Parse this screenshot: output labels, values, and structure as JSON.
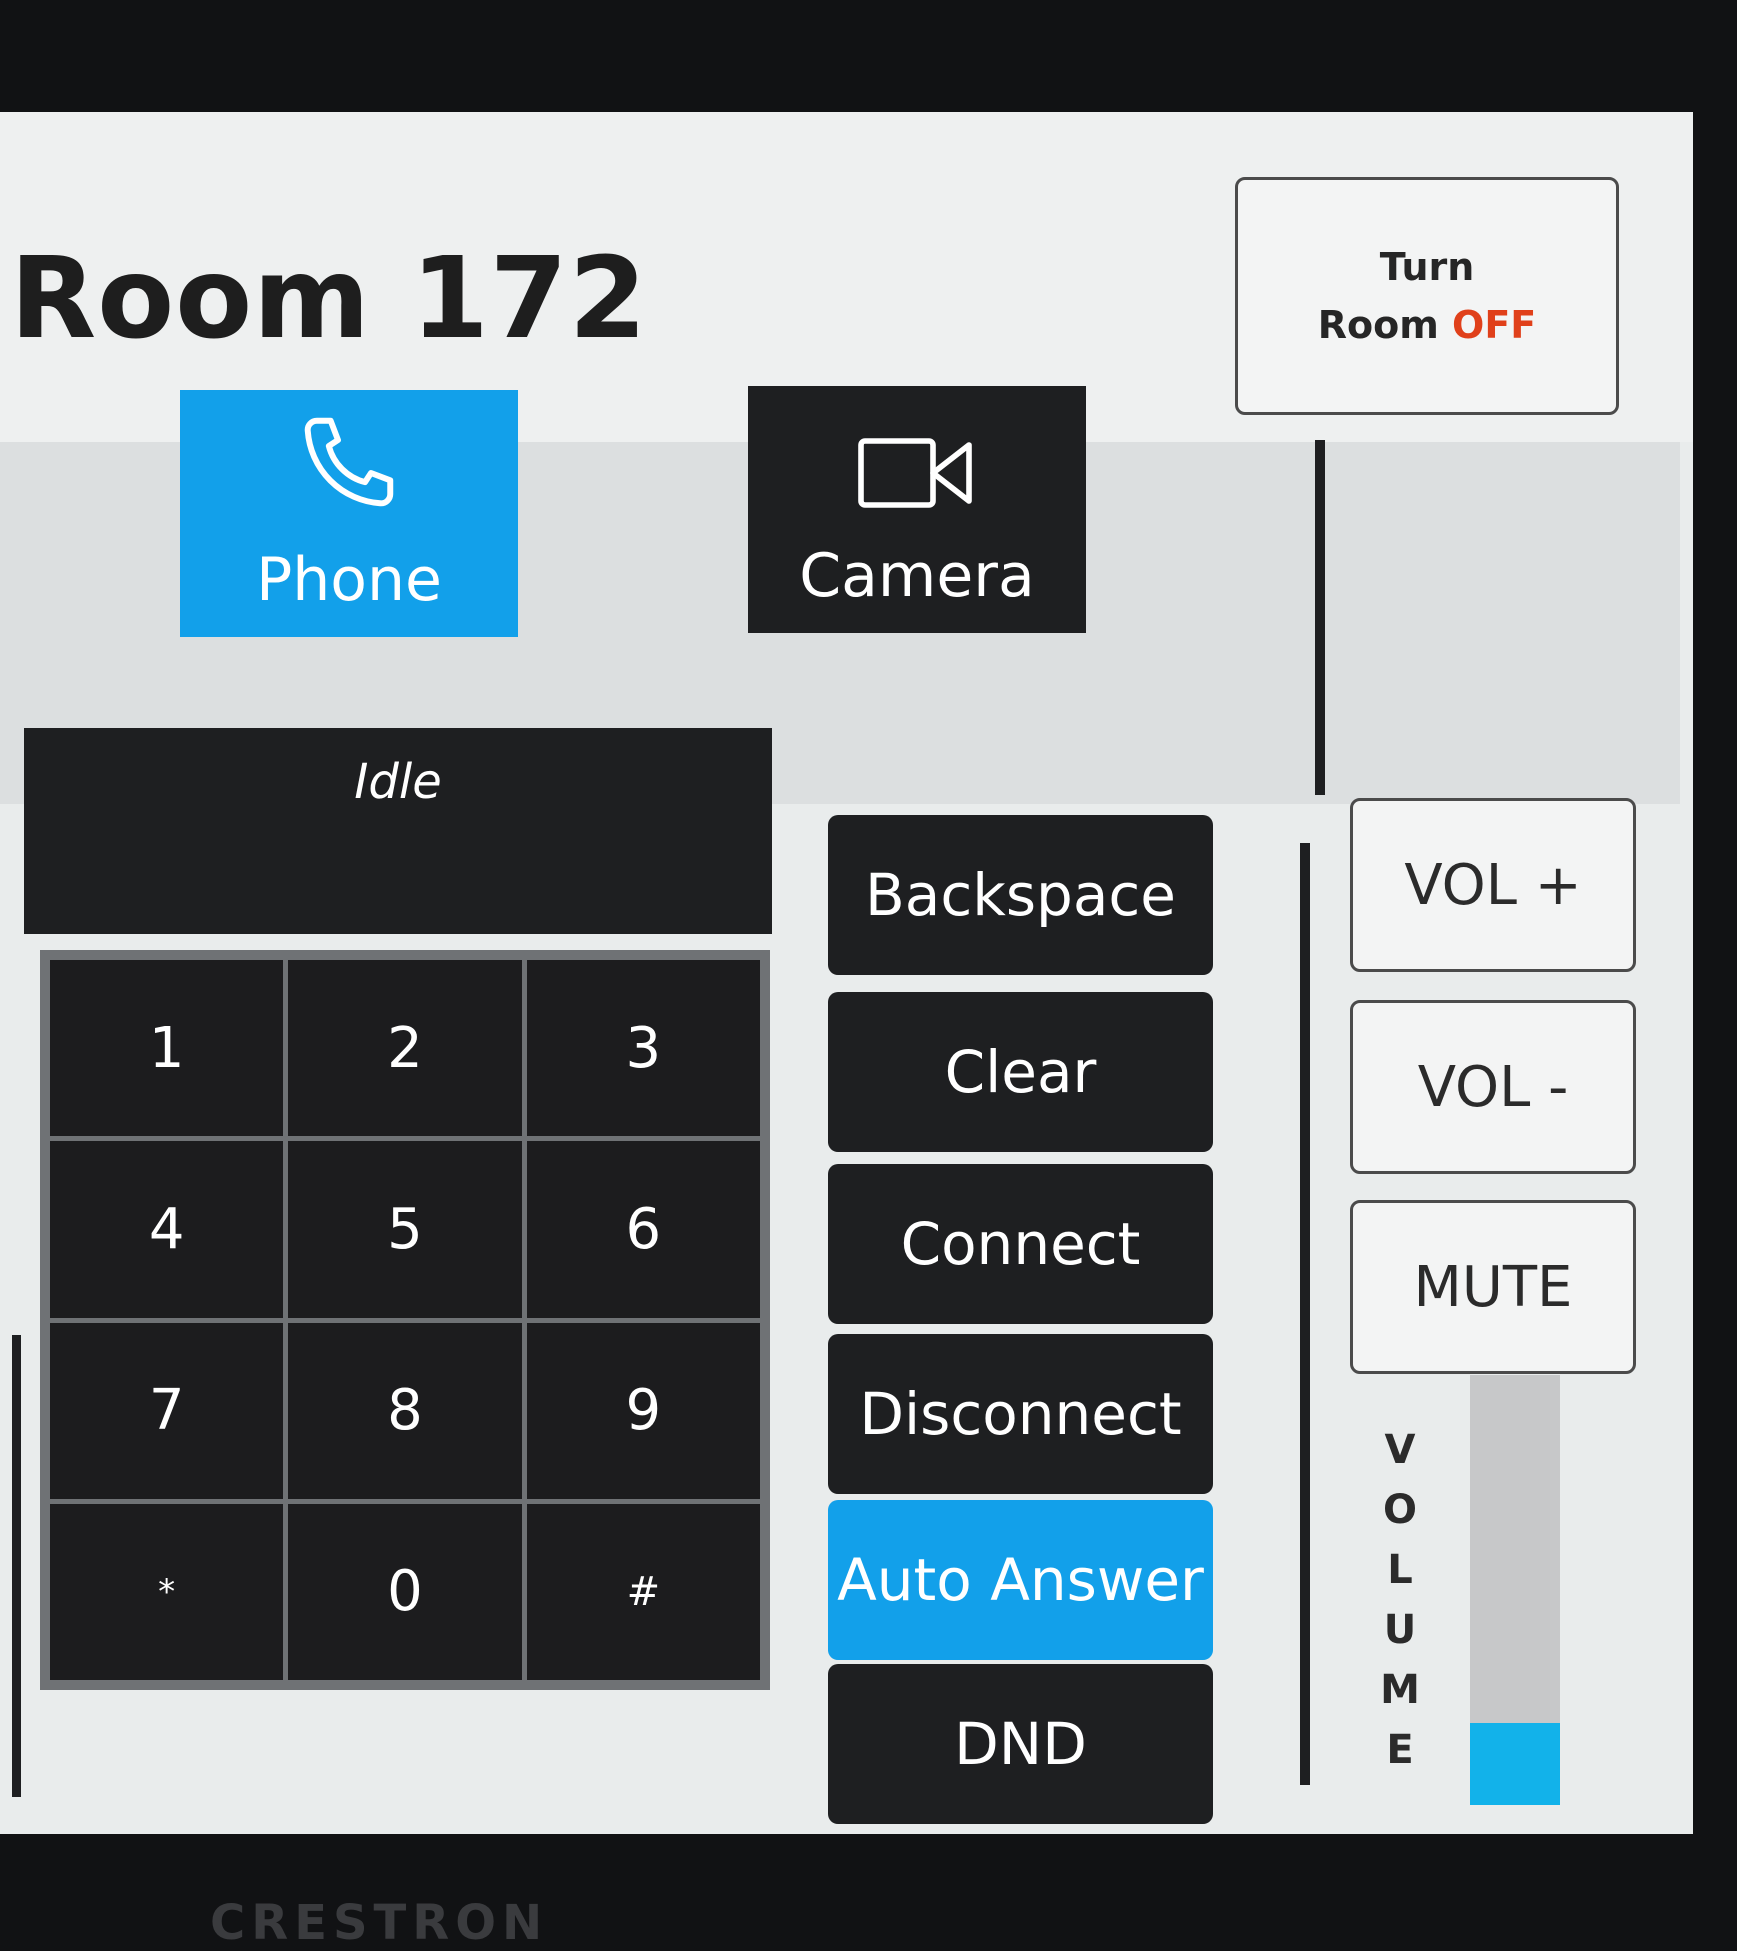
{
  "header": {
    "room_title": "Room 172",
    "power_line1": "Turn",
    "power_line2_prefix": "Room",
    "power_line2_state": "OFF"
  },
  "tabs": [
    {
      "label": "Phone",
      "icon": "phone-icon",
      "active": true
    },
    {
      "label": "Camera",
      "icon": "camera-icon",
      "active": false
    }
  ],
  "dialer": {
    "status": "Idle",
    "keys": [
      "1",
      "2",
      "3",
      "4",
      "5",
      "6",
      "7",
      "8",
      "9",
      "*",
      "0",
      "#"
    ]
  },
  "actions": {
    "backspace": "Backspace",
    "clear": "Clear",
    "connect": "Connect",
    "disconnect": "Disconnect",
    "auto_answer": "Auto Answer",
    "dnd": "DND"
  },
  "audio": {
    "vol_up": "VOL +",
    "vol_down": "VOL -",
    "mute": "MUTE",
    "volume_letters": [
      "V",
      "O",
      "L",
      "U",
      "M",
      "E"
    ],
    "volume_level": 0.19
  },
  "bezel_brand": "CRESTRON",
  "colors": {
    "accent": "#12a0ea",
    "off_text": "#e0401a",
    "button_dark": "#1e1f21"
  }
}
